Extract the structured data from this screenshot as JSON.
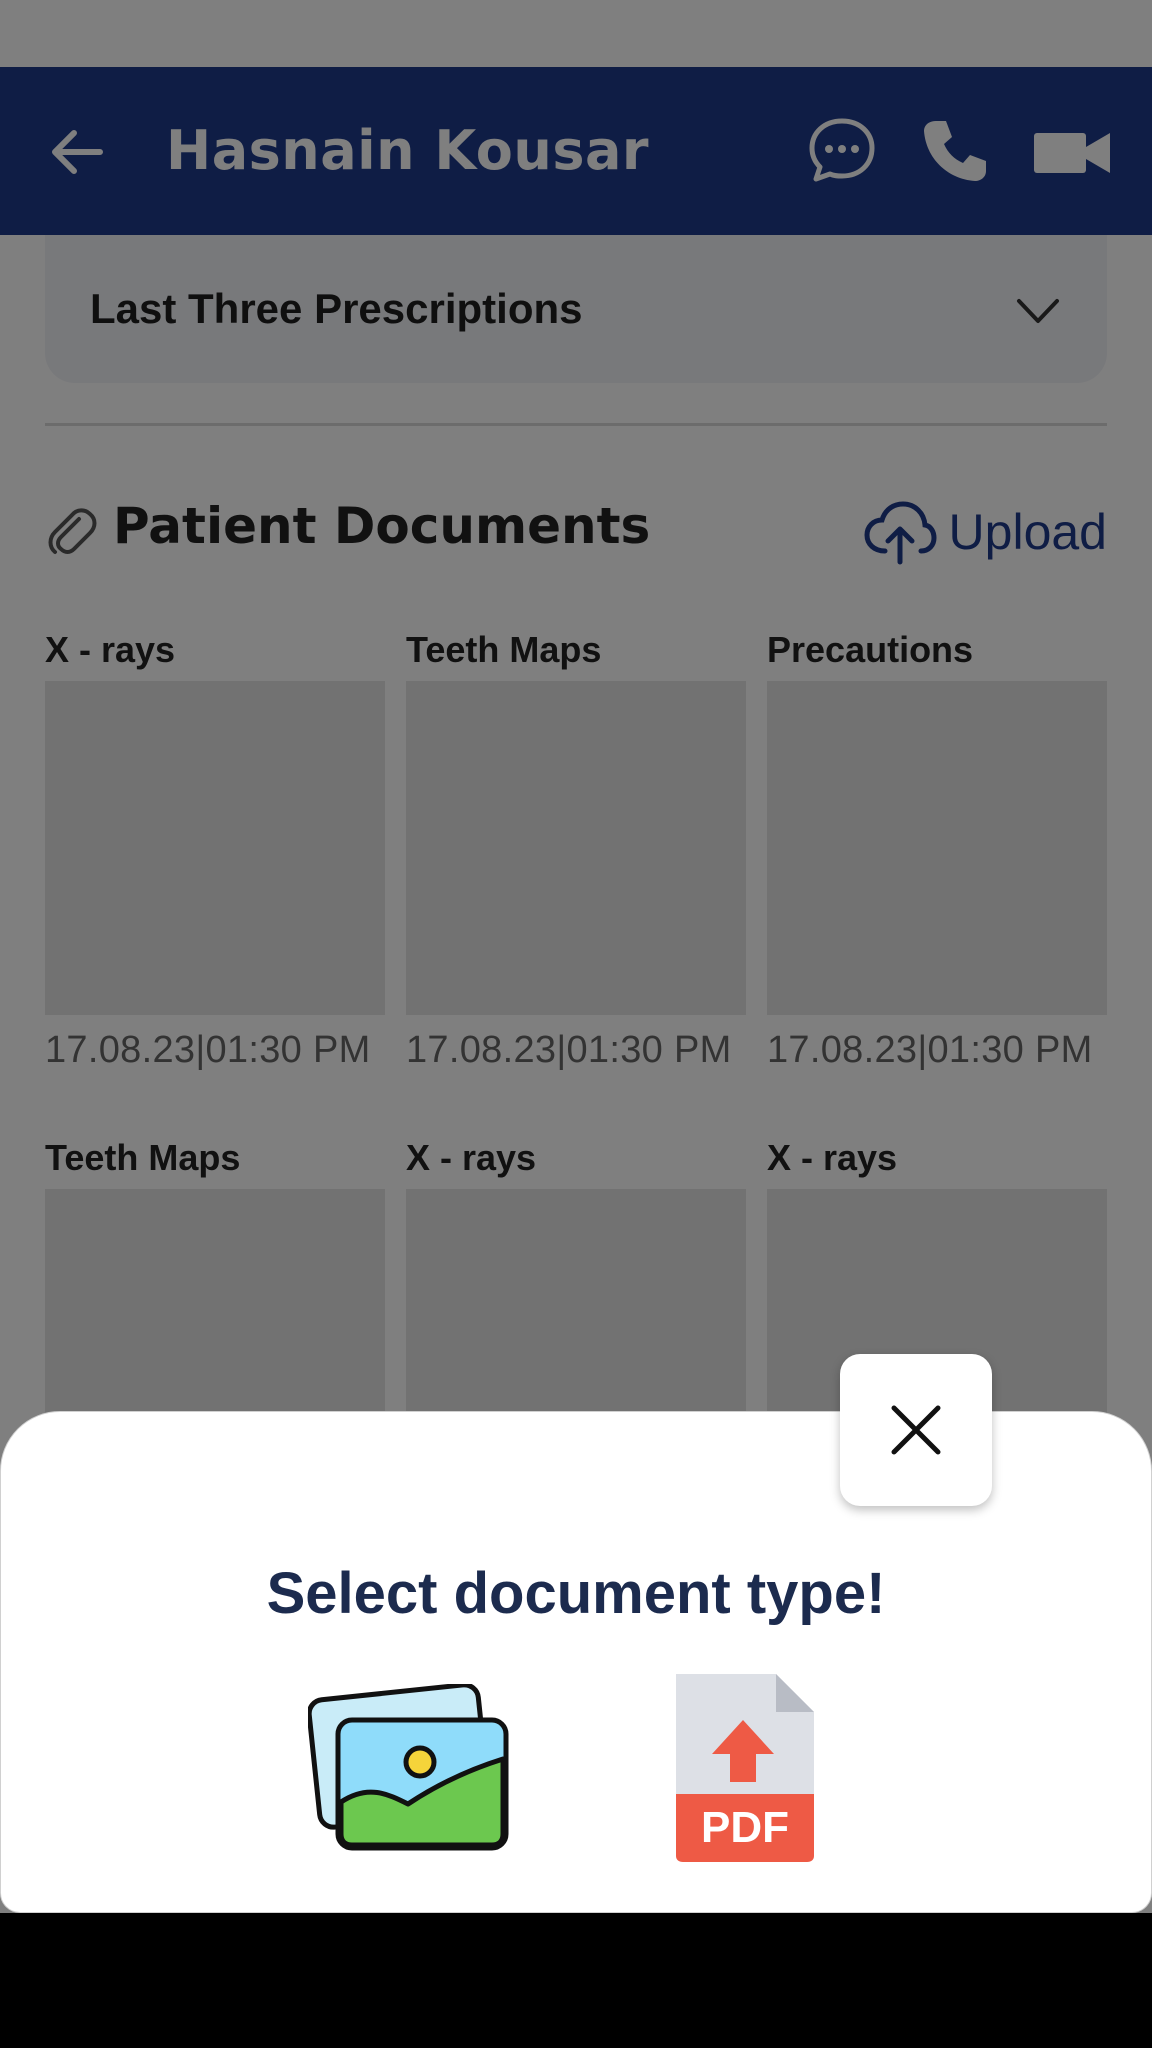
{
  "header": {
    "title": "Hasnain Kousar",
    "back_icon": "arrow-left-icon",
    "actions": [
      "chat-icon",
      "phone-icon",
      "video-camera-icon"
    ],
    "color": "#1f3a8a"
  },
  "prescriptions": {
    "label": "Last Three Prescriptions",
    "icon": "chevron-down-icon"
  },
  "documents": {
    "title": "Patient Documents",
    "upload_label": "Upload",
    "items": [
      {
        "label": "X - rays",
        "date": "17.08.23|01:30 PM"
      },
      {
        "label": "Teeth Maps",
        "date": "17.08.23|01:30 PM"
      },
      {
        "label": "Precautions",
        "date": "17.08.23|01:30 PM"
      },
      {
        "label": "Teeth Maps",
        "date": ""
      },
      {
        "label": "X - rays",
        "date": ""
      },
      {
        "label": "X - rays",
        "date": ""
      }
    ]
  },
  "sheet": {
    "title": "Select document type!",
    "options": [
      "image-gallery-icon",
      "pdf-upload-icon"
    ],
    "close_icon": "close-icon",
    "pdf_text": "PDF"
  }
}
